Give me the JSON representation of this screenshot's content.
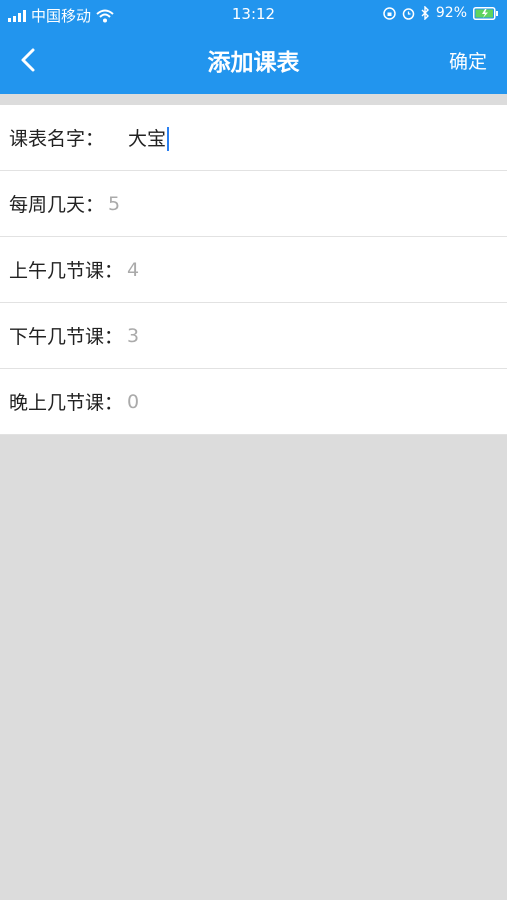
{
  "status_bar": {
    "carrier": "中国移动",
    "time": "13:12",
    "battery": "92%"
  },
  "nav": {
    "title": "添加课表",
    "confirm_label": "确定"
  },
  "form": {
    "name_label": "课表名字：",
    "name_value": "大宝",
    "days_label": "每周几天：",
    "days_value": "5",
    "morning_label": "上午几节课：",
    "morning_value": "4",
    "afternoon_label": "下午几节课：",
    "afternoon_value": "3",
    "evening_label": "晚上几节课：",
    "evening_value": "0"
  },
  "colors": {
    "header": "#2295ee",
    "background": "#dcdcdc",
    "caret": "#2a7ff0"
  }
}
